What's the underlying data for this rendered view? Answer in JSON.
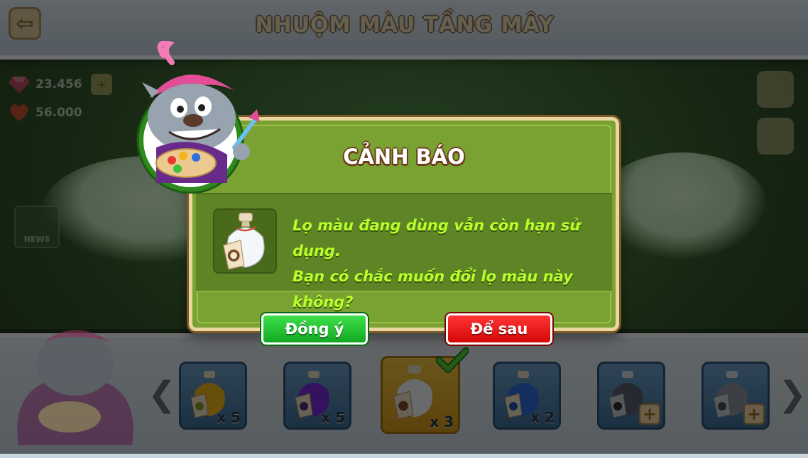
{
  "header": {
    "title": "NHUỘM MÀU TẦNG MÂY",
    "back_icon": "back-arrow-icon"
  },
  "currency": [
    {
      "icon": "gem-icon",
      "value": "23.456"
    },
    {
      "icon": "heart-icon",
      "value": "56.000"
    }
  ],
  "news_label": "NEWS",
  "dialog": {
    "title": "CẢNH BÁO",
    "message_line1": "Lọ màu đang dùng vẫn còn hạn sử dụng.",
    "message_line2": "Bạn có chắc muốn đổi lọ màu này không?",
    "confirm_label": "Đồng ý",
    "later_label": "Để sau",
    "item_icon": "white-dye-bottle-icon"
  },
  "colors": {
    "dialog_green": "#7aa233",
    "message_text": "#b8ff2a",
    "confirm_green": "#11a821",
    "later_red": "#d40707",
    "selected_gold": "#f3c641",
    "slot_blue": "#4f80aa"
  },
  "dye_slots": [
    {
      "name": "yellow-dye",
      "qty": "x 5",
      "color": "#f3b51c",
      "selected": false,
      "addable": false
    },
    {
      "name": "purple-dye",
      "qty": "x 5",
      "color": "#7a2bd8",
      "selected": false,
      "addable": false
    },
    {
      "name": "white-dye",
      "qty": "x 3",
      "color": "#f1f5f8",
      "selected": true,
      "addable": false
    },
    {
      "name": "blue-dye",
      "qty": "x 2",
      "color": "#2f6fe0",
      "selected": false,
      "addable": false
    },
    {
      "name": "black-dye",
      "qty": "",
      "color": "#5a6470",
      "selected": false,
      "addable": true
    },
    {
      "name": "gray-dye",
      "qty": "",
      "color": "#8c949c",
      "selected": false,
      "addable": true
    }
  ],
  "nav": {
    "prev": "❮",
    "next": "❯"
  }
}
